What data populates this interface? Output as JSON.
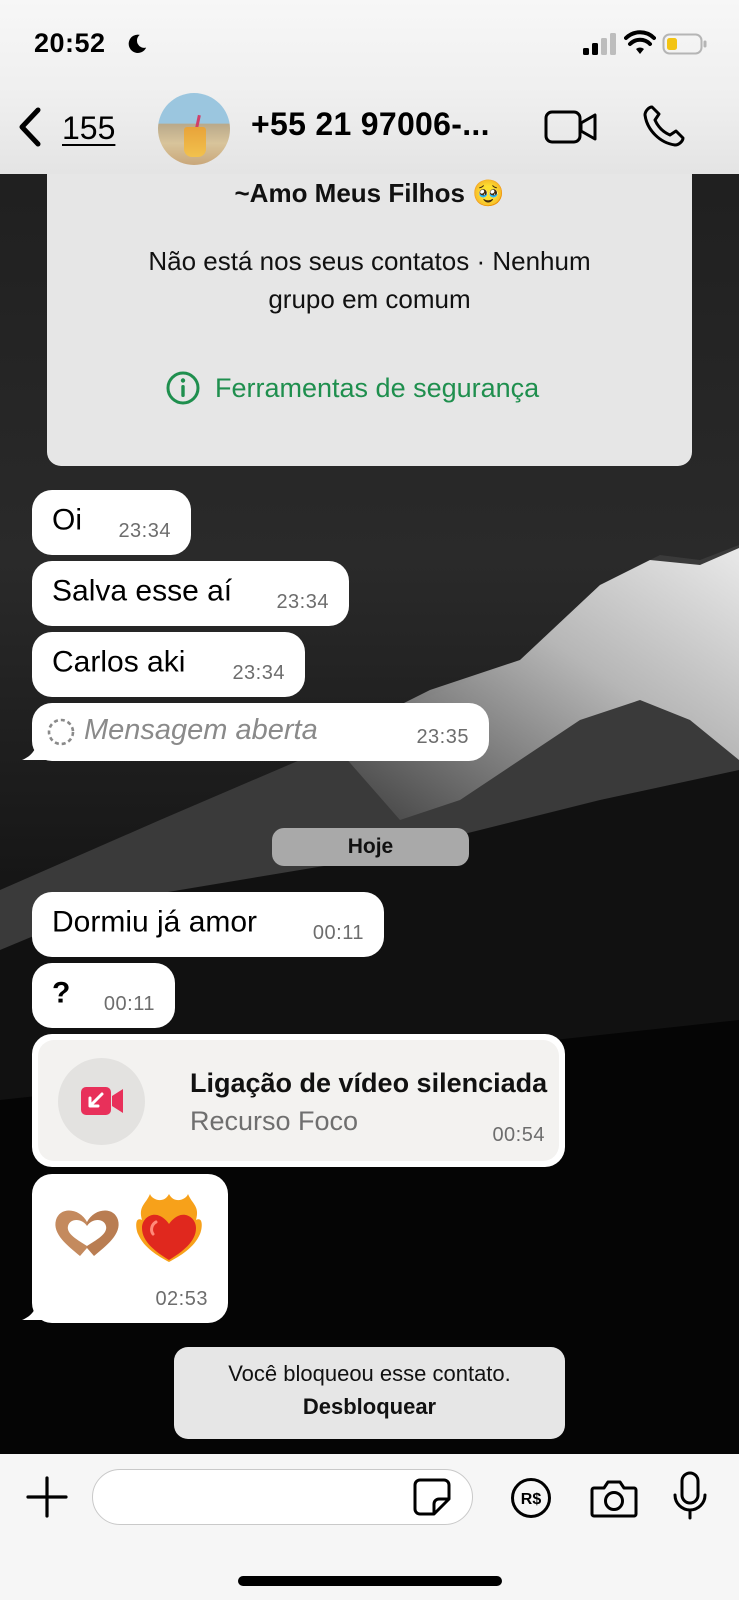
{
  "status_bar": {
    "time": "20:52",
    "icons": [
      "moon-icon",
      "cellular-signal-icon",
      "wifi-icon",
      "battery-icon"
    ]
  },
  "header": {
    "back_count": "155",
    "contact_name": "+55 21 97006-...",
    "icons": [
      "chevron-left-icon",
      "avatar",
      "video-call-icon",
      "phone-call-icon"
    ]
  },
  "info_card": {
    "name": "~Amo Meus Filhos 🥹",
    "description": "Não está nos seus contatos · Nenhum grupo em comum",
    "safety_tools_label": "Ferramentas de segurança",
    "safety_tools_icon": "info-circle-icon",
    "accent_color": "#1f8f4e"
  },
  "messages": [
    {
      "text": "Oi",
      "time": "23:34"
    },
    {
      "text": "Salva esse aí",
      "time": "23:34"
    },
    {
      "text": "Carlos aki",
      "time": "23:34"
    },
    {
      "text": "Mensagem aberta",
      "time": "23:35",
      "icon": "view-once-opened-icon"
    }
  ],
  "date_separator": "Hoje",
  "messages_today": [
    {
      "text": "Dormiu já amor",
      "time": "00:11"
    },
    {
      "text": "?",
      "time": "00:11"
    }
  ],
  "call_card": {
    "title": "Ligação de vídeo silenciada",
    "subtitle": "Recurso Foco",
    "time": "00:54",
    "icon": "missed-video-call-icon",
    "icon_color": "#e8305a"
  },
  "emoji_message": {
    "emojis": [
      "heart-hands-emoji",
      "heart-on-fire-emoji"
    ],
    "time": "02:53"
  },
  "blocked_notice": {
    "text": "Você bloqueou esse contato.",
    "action": "Desbloquear"
  },
  "input_bar": {
    "message_value": "",
    "icons": [
      "plus-icon",
      "sticker-icon",
      "pix-payment-icon",
      "camera-icon",
      "microphone-icon"
    ]
  }
}
